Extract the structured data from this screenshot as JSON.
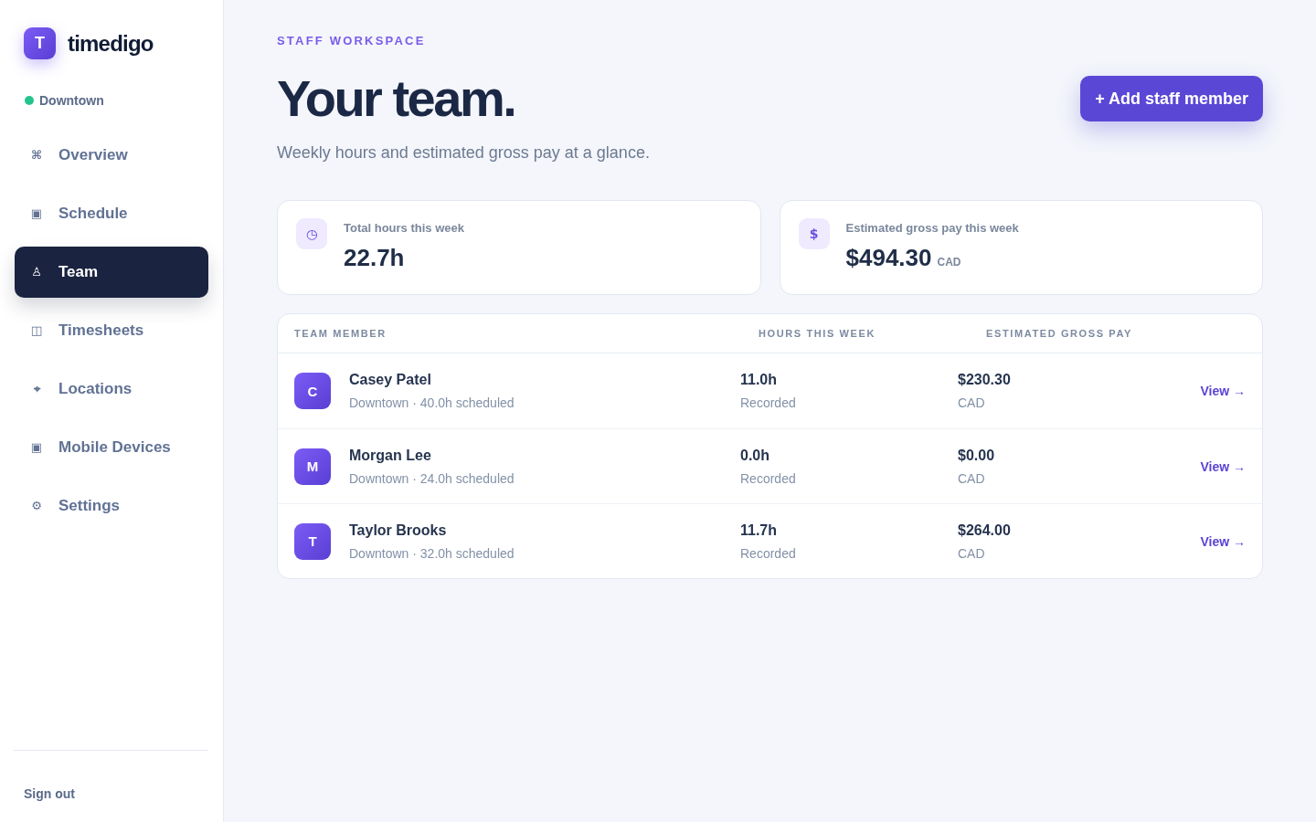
{
  "sidebar": {
    "logo": {
      "initial": "T",
      "name": "timedigo"
    },
    "location": "Downtown",
    "nav": [
      {
        "icon": "⌘",
        "label": "Overview",
        "selected": false
      },
      {
        "icon": "▣",
        "label": "Schedule",
        "selected": false
      },
      {
        "icon": "♙",
        "label": "Team",
        "selected": true
      },
      {
        "icon": "◫",
        "label": "Timesheets",
        "selected": false
      },
      {
        "icon": "⌖",
        "label": "Locations",
        "selected": false
      },
      {
        "icon": "▣",
        "label": "Mobile Devices",
        "selected": false
      },
      {
        "icon": "⚙",
        "label": "Settings",
        "selected": false
      }
    ],
    "sign_out": "Sign out"
  },
  "header": {
    "eyebrow": "STAFF WORKSPACE",
    "title": "Your team.",
    "subtitle": "Weekly hours and estimated gross pay at a glance.",
    "action": "+ Add staff member"
  },
  "stats": [
    {
      "icon": "◷",
      "label": "Total hours this week",
      "value": "22.7h"
    },
    {
      "icon": "$",
      "label": "Estimated gross pay this week",
      "value": "$494.30",
      "unit": "CAD"
    }
  ],
  "table": {
    "columns": [
      "TEAM MEMBER",
      "HOURS THIS WEEK",
      "ESTIMATED GROSS PAY"
    ],
    "rows": [
      {
        "initial": "C",
        "name": "Casey Patel",
        "detail": "Downtown · 40.0h scheduled",
        "hours": "11.0h",
        "hours_note": "Recorded",
        "pay": "$230.30",
        "currency": "CAD",
        "action": "View →"
      },
      {
        "initial": "M",
        "name": "Morgan Lee",
        "detail": "Downtown · 24.0h scheduled",
        "hours": "0.0h",
        "hours_note": "Recorded",
        "pay": "$0.00",
        "currency": "CAD",
        "action": "View →"
      },
      {
        "initial": "T",
        "name": "Taylor Brooks",
        "detail": "Downtown · 32.0h scheduled",
        "hours": "11.7h",
        "hours_note": "Recorded",
        "pay": "$264.00",
        "currency": "CAD",
        "action": "View →"
      }
    ]
  }
}
